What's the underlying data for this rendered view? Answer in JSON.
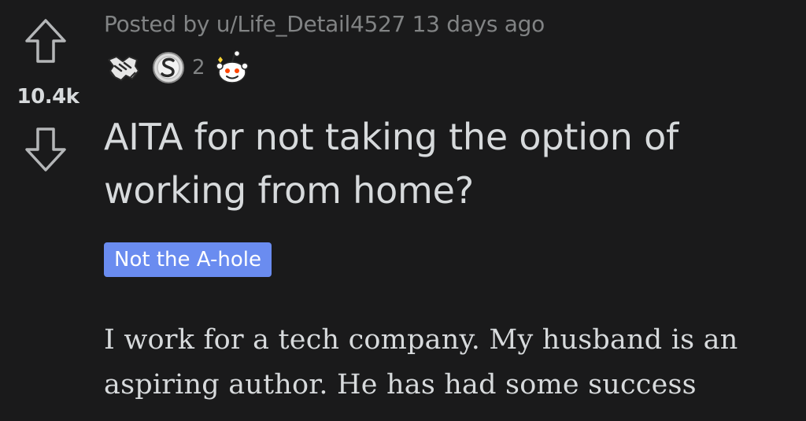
{
  "post": {
    "meta": {
      "posted_by_prefix": "Posted by ",
      "username": "u/Life_Detail4527",
      "time_ago": " 13 days ago"
    },
    "awards": [
      {
        "icon": "handshake-award-icon"
      },
      {
        "icon": "silver-award-icon",
        "count": "2"
      },
      {
        "icon": "wholesome-snoo-award-icon"
      }
    ],
    "votes": {
      "score": "10.4k",
      "upvote_icon": "upvote-arrow-icon",
      "downvote_icon": "downvote-arrow-icon"
    },
    "title": "AITA for not taking the option of working from home?",
    "flair": {
      "label": "Not the A-hole",
      "color": "#6a8cf0"
    },
    "body": "I work for a tech company. My husband is an aspiring author. He has had some success"
  },
  "colors": {
    "background": "#1a1a1b",
    "text": "#d7dadc",
    "meta": "#818384"
  }
}
